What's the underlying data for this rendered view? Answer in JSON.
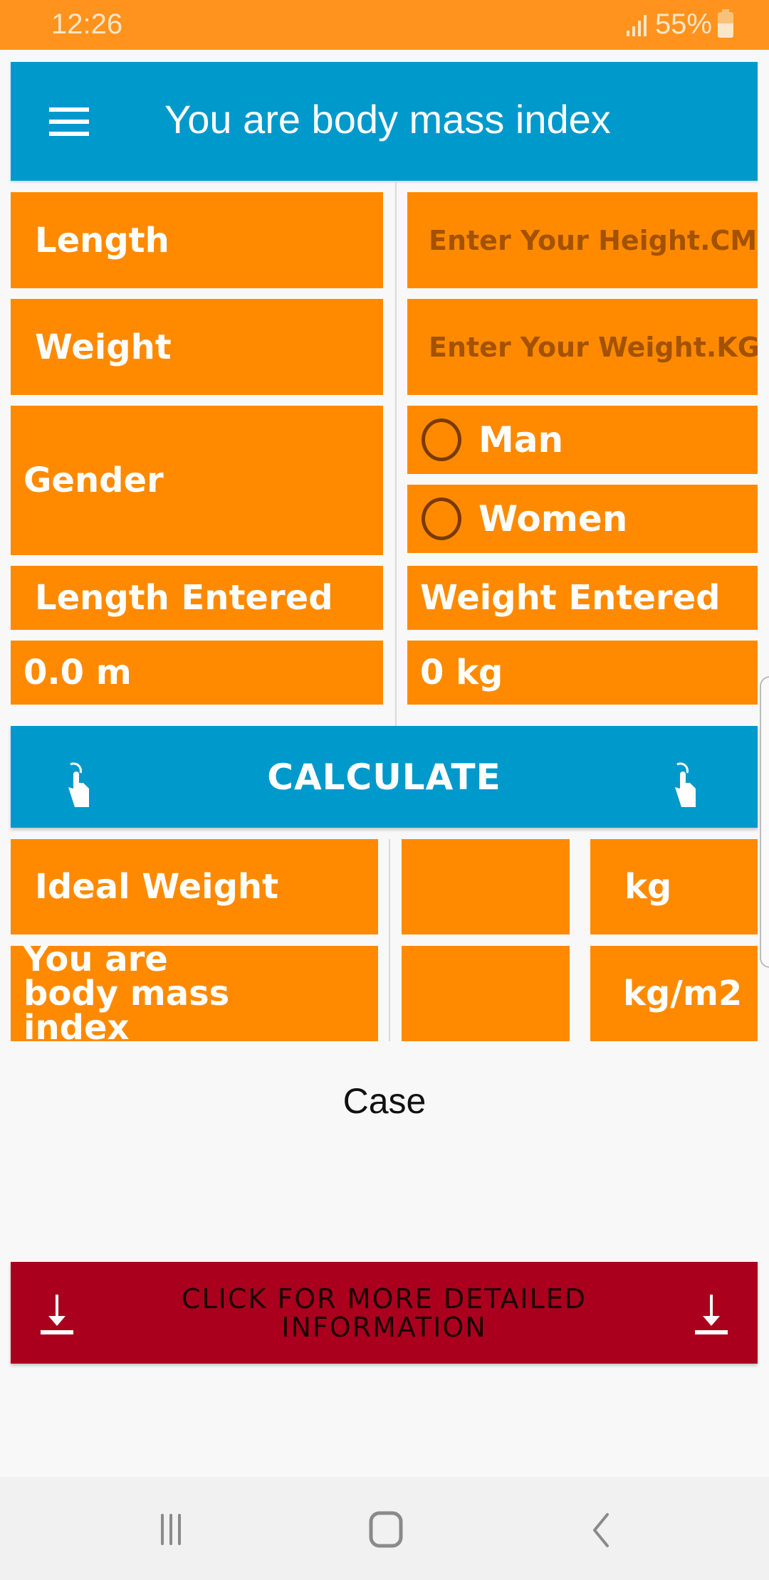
{
  "status_bar": {
    "time": "12:26",
    "battery_percent": "55%",
    "battery_level": 0.55
  },
  "app_bar": {
    "menu_icon": "hamburger-menu-icon",
    "title": "You are body mass index"
  },
  "form": {
    "length_label": "Length",
    "height_input": {
      "value": "",
      "placeholder": "Enter Your Height.CM"
    },
    "weight_label": "Weight",
    "weight_input": {
      "value": "",
      "placeholder": "Enter Your Weight.KG"
    },
    "gender_label": "Gender",
    "gender_options": [
      {
        "label": "Man",
        "checked": false
      },
      {
        "label": "Women",
        "checked": false
      }
    ],
    "length_entered_label": "Length Entered",
    "weight_entered_label": "Weight Entered",
    "length_entered_value": "0.0 m",
    "weight_entered_value": "0 kg"
  },
  "calculate_button": {
    "label": "CALCULATE",
    "icon": "tap-hand-icon"
  },
  "results": {
    "ideal_weight_label": "Ideal Weight",
    "ideal_weight_value": "",
    "ideal_weight_unit": "kg",
    "bmi_label": "You are body mass index",
    "bmi_value": "",
    "bmi_unit": "kg/m2"
  },
  "case_text": "Case",
  "more_info_button": {
    "label": "CLICK FOR MORE DETAILED INFORMATION",
    "icon": "download-icon"
  },
  "nav_bar": {
    "recents": "recent-apps-icon",
    "home": "home-icon",
    "back": "back-icon"
  },
  "colors": {
    "status_bar": "#FF931E",
    "primary_blue": "#0099CC",
    "tile_orange": "#FF8A00",
    "placeholder_brown": "#A35200",
    "more_button_red": "#AA001E"
  }
}
